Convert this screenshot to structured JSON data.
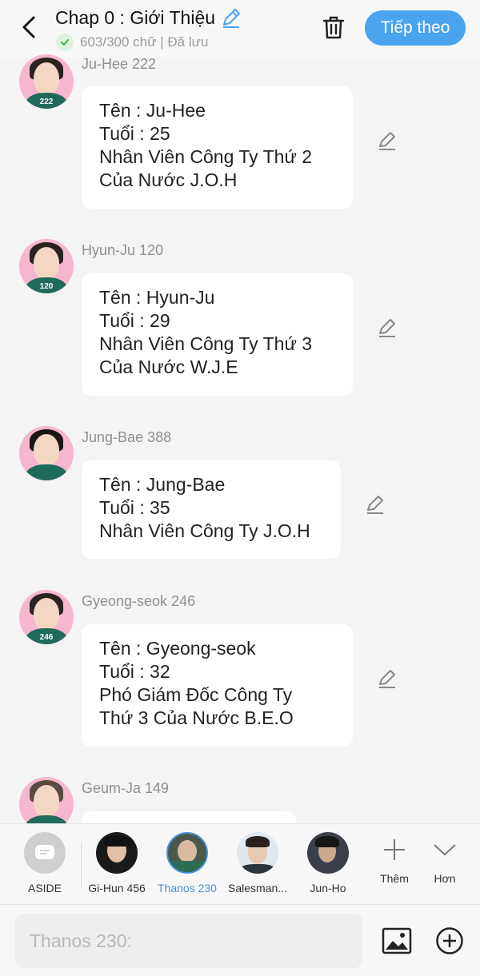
{
  "header": {
    "title": "Chap 0 : Giới Thiệu",
    "status": "603/300 chữ | Đã lưu",
    "next_label": "Tiếp theo"
  },
  "messages": [
    {
      "name": "Ju-Hee 222",
      "avatar_number": "222",
      "lines": [
        "Tên : Ju-Hee",
        "Tuổi : 25",
        "Nhân Viên Công Ty Thứ 2",
        "Của Nước J.O.H"
      ]
    },
    {
      "name": "Hyun-Ju 120",
      "avatar_number": "120",
      "lines": [
        "Tên : Hyun-Ju",
        "Tuổi : 29",
        "Nhân Viên Công Ty Thứ 3",
        "Của Nước W.J.E"
      ]
    },
    {
      "name": "Jung-Bae 388",
      "avatar_number": "",
      "lines": [
        "Tên : Jung-Bae",
        "Tuổi : 35",
        "Nhân Viên Công Ty J.O.H"
      ]
    },
    {
      "name": "Gyeong-seok 246",
      "avatar_number": "246",
      "lines": [
        "Tên : Gyeong-seok",
        "Tuổi : 32",
        "Phó Giám Đốc Công Ty",
        "Thứ 3 Của Nước B.E.O"
      ]
    },
    {
      "name": "Geum-Ja 149",
      "avatar_number": "",
      "lines": []
    }
  ],
  "character_bar": {
    "aside_label": "ASIDE",
    "characters": [
      {
        "label": "Gi-Hun 456",
        "active": false
      },
      {
        "label": "Thanos 230",
        "active": true
      },
      {
        "label": "Salesman...",
        "active": false
      },
      {
        "label": "Jun-Ho",
        "active": false
      }
    ],
    "add_label": "Thêm",
    "more_label": "Hơn"
  },
  "input": {
    "placeholder": "Thanos 230:"
  },
  "colors": {
    "accent": "#4aa3ee",
    "active_character": "#4a90d9",
    "avatar_bg": "#f7b6cf",
    "saved_check": "#3bb34a"
  }
}
